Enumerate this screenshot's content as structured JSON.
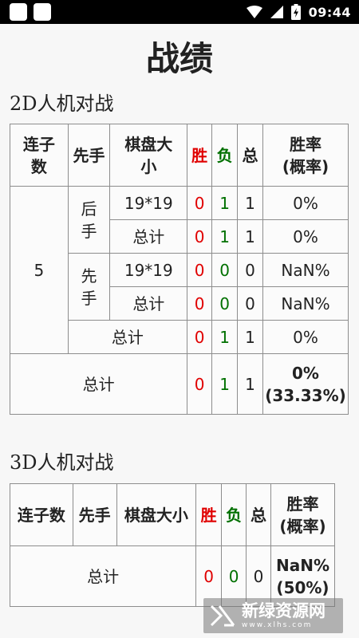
{
  "status_bar": {
    "time": "09:44"
  },
  "title": "战绩",
  "section_2d": {
    "title": "2D人机对战",
    "headers": {
      "lianzishu": "连子\n数",
      "xianshou": "先手",
      "qipan": "棋盘大\n小",
      "win": "胜",
      "loss": "负",
      "total": "总",
      "rate": "胜率\n(概率)"
    },
    "lianzishu_value": "5",
    "groups": [
      {
        "label": "后\n手",
        "rows": [
          {
            "size": "19*19",
            "win": "0",
            "loss": "1",
            "total": "1",
            "rate": "0%"
          },
          {
            "size": "总计",
            "win": "0",
            "loss": "1",
            "total": "1",
            "rate": "0%"
          }
        ]
      },
      {
        "label": "先\n手",
        "rows": [
          {
            "size": "19*19",
            "win": "0",
            "loss": "0",
            "total": "0",
            "rate": "NaN%"
          },
          {
            "size": "总计",
            "win": "0",
            "loss": "0",
            "total": "0",
            "rate": "NaN%"
          }
        ]
      }
    ],
    "subtotal": {
      "label": "总计",
      "win": "0",
      "loss": "1",
      "total": "1",
      "rate": "0%"
    },
    "grand_total": {
      "label": "总计",
      "win": "0",
      "loss": "1",
      "total": "1",
      "rate": "0%\n(33.33%)"
    }
  },
  "section_3d": {
    "title": "3D人机对战",
    "headers": {
      "lianzishu": "连子数",
      "xianshou": "先手",
      "qipan": "棋盘大小",
      "win": "胜",
      "loss": "负",
      "total": "总",
      "rate": "胜率\n(概率)"
    },
    "grand_total": {
      "label": "总计",
      "win": "0",
      "loss": "0",
      "total": "0",
      "rate": "NaN%\n(50%)"
    }
  },
  "watermark": {
    "text": "新绿资源网",
    "sub": "www.xlhs.com"
  },
  "colors": {
    "win": "#e00000",
    "loss": "#007000"
  }
}
